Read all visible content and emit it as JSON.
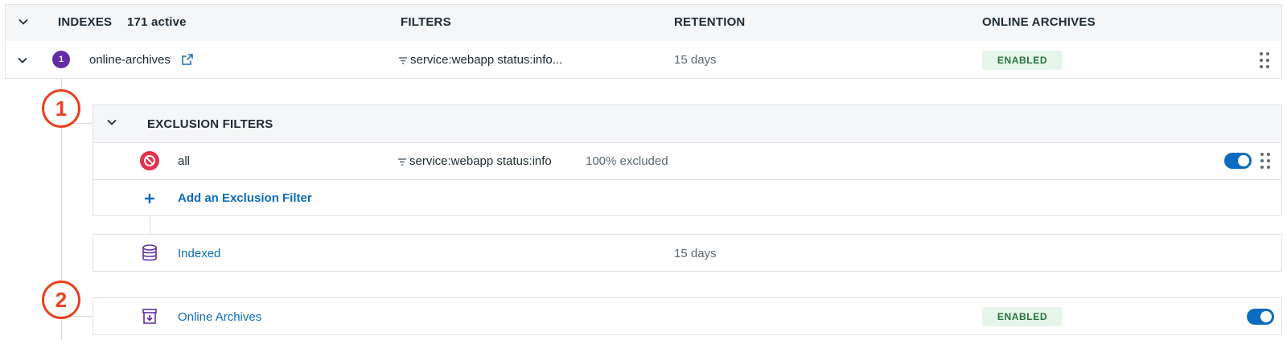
{
  "header": {
    "indexes_label": "INDEXES",
    "active_count": "171 active",
    "filters_label": "FILTERS",
    "retention_label": "RETENTION",
    "online_archives_label": "ONLINE ARCHIVES"
  },
  "index_row": {
    "badge": "1",
    "name": "online-archives",
    "filter": "service:webapp status:info...",
    "retention": "15 days",
    "archive_status": "ENABLED"
  },
  "steps": [
    "1",
    "2"
  ],
  "exclusion": {
    "title": "EXCLUSION FILTERS",
    "filter_name": "all",
    "filter_query": "service:webapp status:info",
    "excluded": "100% excluded",
    "toggle_on": true,
    "add_label": "Add an Exclusion Filter"
  },
  "indexed": {
    "label": "Indexed",
    "retention": "15 days"
  },
  "archives": {
    "label": "Online Archives",
    "status": "ENABLED",
    "toggle_on": true
  },
  "colors": {
    "accent": "#0b6cbf",
    "purple": "#632ca6",
    "step": "#e8401e",
    "enabled_bg": "#e6f5ea",
    "enabled_text": "#25733b",
    "block_red": "#e5304b"
  }
}
